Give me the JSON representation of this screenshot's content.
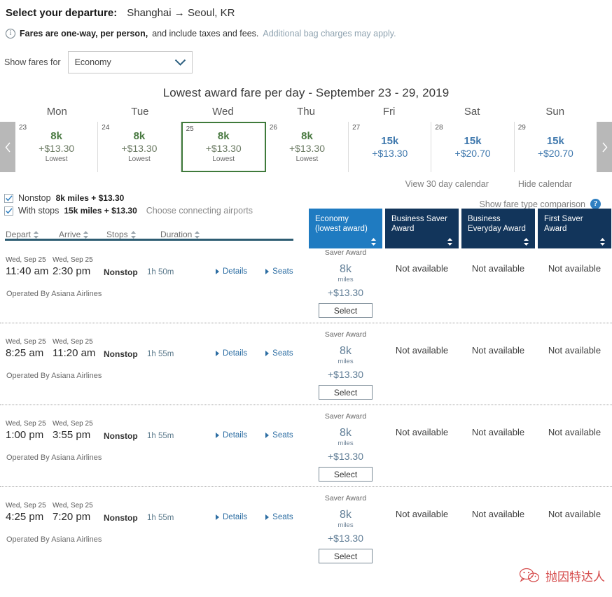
{
  "header": {
    "label": "Select your departure:",
    "route": "Shanghai → Seoul, KR"
  },
  "fare_note": {
    "icon": "info-icon",
    "bold": "Fares are one-way, per person,",
    "rest": " and include taxes and fees.",
    "link": "Additional bag charges may apply."
  },
  "show_fares": {
    "label": "Show fares for",
    "value": "Economy",
    "icon": "chevron-down-icon"
  },
  "calendar": {
    "title": "Lowest award fare per day - September 23 - 29, 2019",
    "prev_icon": "chevron-left-icon",
    "next_icon": "chevron-right-icon",
    "weekdays": [
      "Mon",
      "Tue",
      "Wed",
      "Thu",
      "Fri",
      "Sat",
      "Sun"
    ],
    "days": [
      {
        "day": "23",
        "miles": "8k",
        "tax": "+$13.30",
        "note": "Lowest",
        "tone": "green",
        "selected": false
      },
      {
        "day": "24",
        "miles": "8k",
        "tax": "+$13.30",
        "note": "Lowest",
        "tone": "green",
        "selected": false
      },
      {
        "day": "25",
        "miles": "8k",
        "tax": "+$13.30",
        "note": "Lowest",
        "tone": "green",
        "selected": true
      },
      {
        "day": "26",
        "miles": "8k",
        "tax": "+$13.30",
        "note": "Lowest",
        "tone": "green",
        "selected": false
      },
      {
        "day": "27",
        "miles": "15k",
        "tax": "+$13.30",
        "note": "",
        "tone": "blue",
        "selected": false
      },
      {
        "day": "28",
        "miles": "15k",
        "tax": "+$20.70",
        "note": "",
        "tone": "blue",
        "selected": false
      },
      {
        "day": "29",
        "miles": "15k",
        "tax": "+$20.70",
        "note": "",
        "tone": "blue",
        "selected": false
      }
    ],
    "view30": "View 30 day calendar",
    "hide": "Hide calendar"
  },
  "filters": {
    "nonstop": {
      "label": "Nonstop",
      "amount": "8k miles + $13.30",
      "checked": true
    },
    "withstops": {
      "label": "With stops",
      "amount": "15k miles + $13.30",
      "checked": true,
      "choose": "Choose connecting airports"
    }
  },
  "comparison": {
    "label": "Show fare type comparison",
    "icon": "help-icon"
  },
  "sort_columns": [
    "Depart",
    "Arrive",
    "Stops",
    "Duration"
  ],
  "fare_classes": [
    {
      "line1": "Economy",
      "line2": "(lowest award)",
      "active": true
    },
    {
      "line1": "Business Saver",
      "line2": "Award",
      "active": false
    },
    {
      "line1": "Business",
      "line2": "Everyday Award",
      "active": false
    },
    {
      "line1": "First Saver Award",
      "line2": "",
      "active": false
    }
  ],
  "labels": {
    "details": "Details",
    "seats": "Seats",
    "select": "Select",
    "not_available": "Not available",
    "saver_award": "Saver Award",
    "miles_unit": "miles",
    "operated_by": "Operated By Asiana Airlines"
  },
  "flights": [
    {
      "depart_date": "Wed, Sep 25",
      "depart_time": "11:40 am",
      "arrive_date": "Wed, Sep 25",
      "arrive_time": "2:30 pm",
      "stops": "Nonstop",
      "duration": "1h 50m",
      "operator": "Operated By Asiana Airlines",
      "fares": [
        {
          "available": true,
          "tier": "Saver Award",
          "miles": "8k",
          "unit": "miles",
          "tax": "+$13.30",
          "button": "Select"
        },
        {
          "available": false,
          "text": "Not available"
        },
        {
          "available": false,
          "text": "Not available"
        },
        {
          "available": false,
          "text": "Not available"
        }
      ]
    },
    {
      "depart_date": "Wed, Sep 25",
      "depart_time": "8:25 am",
      "arrive_date": "Wed, Sep 25",
      "arrive_time": "11:20 am",
      "stops": "Nonstop",
      "duration": "1h 55m",
      "operator": "Operated By Asiana Airlines",
      "fares": [
        {
          "available": true,
          "tier": "Saver Award",
          "miles": "8k",
          "unit": "miles",
          "tax": "+$13.30",
          "button": "Select"
        },
        {
          "available": false,
          "text": "Not available"
        },
        {
          "available": false,
          "text": "Not available"
        },
        {
          "available": false,
          "text": "Not available"
        }
      ]
    },
    {
      "depart_date": "Wed, Sep 25",
      "depart_time": "1:00 pm",
      "arrive_date": "Wed, Sep 25",
      "arrive_time": "3:55 pm",
      "stops": "Nonstop",
      "duration": "1h 55m",
      "operator": "Operated By Asiana Airlines",
      "fares": [
        {
          "available": true,
          "tier": "Saver Award",
          "miles": "8k",
          "unit": "miles",
          "tax": "+$13.30",
          "button": "Select"
        },
        {
          "available": false,
          "text": "Not available"
        },
        {
          "available": false,
          "text": "Not available"
        },
        {
          "available": false,
          "text": "Not available"
        }
      ]
    },
    {
      "depart_date": "Wed, Sep 25",
      "depart_time": "4:25 pm",
      "arrive_date": "Wed, Sep 25",
      "arrive_time": "7:20 pm",
      "stops": "Nonstop",
      "duration": "1h 55m",
      "operator": "Operated By Asiana Airlines",
      "fares": [
        {
          "available": true,
          "tier": "Saver Award",
          "miles": "8k",
          "unit": "miles",
          "tax": "+$13.30",
          "button": "Select"
        },
        {
          "available": false,
          "text": "Not available"
        },
        {
          "available": false,
          "text": "Not available"
        },
        {
          "available": false,
          "text": "Not available"
        }
      ]
    }
  ],
  "watermark": {
    "text": "抛因特达人",
    "icon": "wechat-icon",
    "color": "#d23c3c"
  }
}
